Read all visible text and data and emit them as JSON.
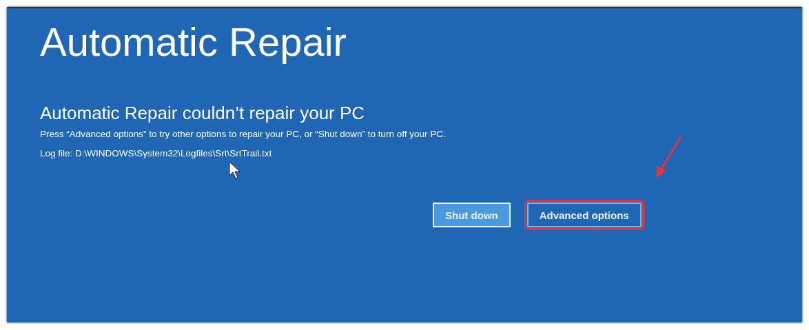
{
  "title": "Automatic Repair",
  "heading": "Automatic Repair couldn’t repair your PC",
  "message": "Press “Advanced options” to try other options to repair your PC, or “Shut down” to turn off your PC.",
  "log_file": "Log file: D:\\WINDOWS\\System32\\Logfiles\\Srt\\SrtTrail.txt",
  "buttons": [
    {
      "label": "Shut down",
      "selected": true,
      "highlighted": false
    },
    {
      "label": "Advanced options",
      "selected": false,
      "highlighted": true
    }
  ]
}
